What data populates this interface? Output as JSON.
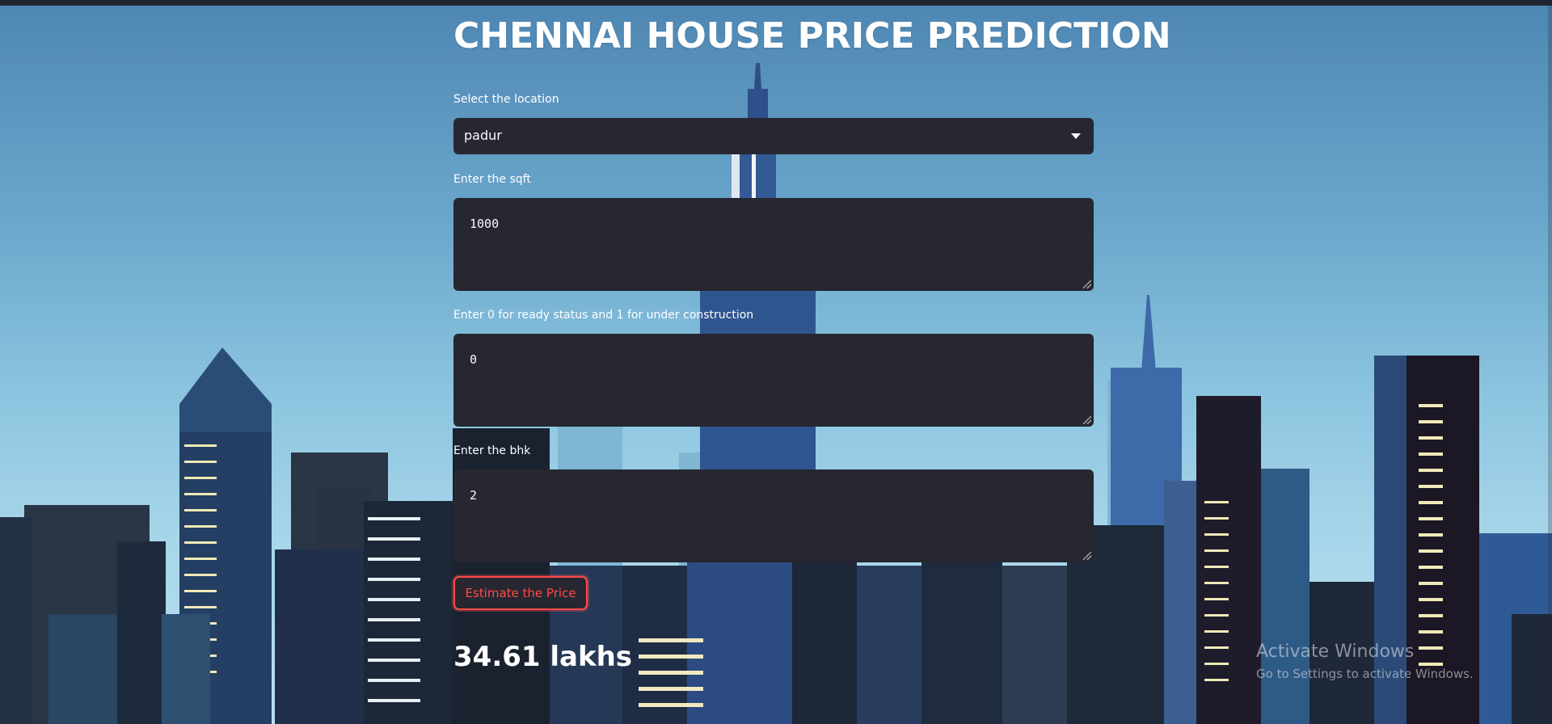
{
  "app": {
    "title": "CHENNAI HOUSE PRICE PREDICTION"
  },
  "form": {
    "location": {
      "label": "Select the location",
      "selected": "padur"
    },
    "sqft": {
      "label": "Enter the sqft",
      "value": "1000"
    },
    "status": {
      "label": "Enter 0 for ready status and 1 for under construction",
      "value": "0"
    },
    "bhk": {
      "label": "Enter the bhk",
      "value": "2"
    },
    "submit_label": "Estimate the Price"
  },
  "result": {
    "text": "34.61 lakhs"
  },
  "watermark": {
    "line1": "Activate Windows",
    "line2": "Go to Settings to activate Windows."
  },
  "colors": {
    "accent": "#ff4b4b",
    "input_bg": "#262730",
    "text": "#ffffff"
  }
}
